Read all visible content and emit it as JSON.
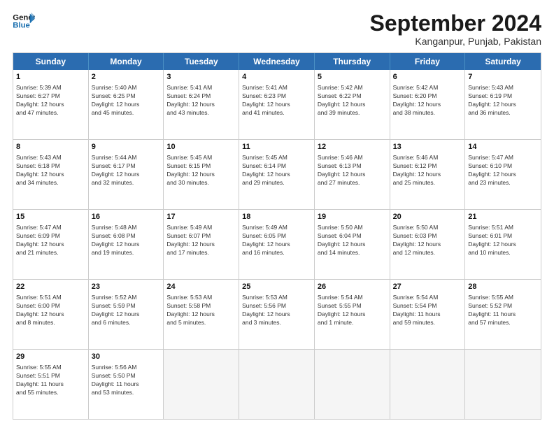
{
  "logo": {
    "line1": "General",
    "line2": "Blue"
  },
  "header": {
    "title": "September 2024",
    "subtitle": "Kanganpur, Punjab, Pakistan"
  },
  "days": [
    "Sunday",
    "Monday",
    "Tuesday",
    "Wednesday",
    "Thursday",
    "Friday",
    "Saturday"
  ],
  "rows": [
    [
      {
        "day": "",
        "empty": true,
        "content": ""
      },
      {
        "day": "2",
        "content": "Sunrise: 5:40 AM\nSunset: 6:25 PM\nDaylight: 12 hours\nand 45 minutes."
      },
      {
        "day": "3",
        "content": "Sunrise: 5:41 AM\nSunset: 6:24 PM\nDaylight: 12 hours\nand 43 minutes."
      },
      {
        "day": "4",
        "content": "Sunrise: 5:41 AM\nSunset: 6:23 PM\nDaylight: 12 hours\nand 41 minutes."
      },
      {
        "day": "5",
        "content": "Sunrise: 5:42 AM\nSunset: 6:22 PM\nDaylight: 12 hours\nand 39 minutes."
      },
      {
        "day": "6",
        "content": "Sunrise: 5:42 AM\nSunset: 6:20 PM\nDaylight: 12 hours\nand 38 minutes."
      },
      {
        "day": "7",
        "content": "Sunrise: 5:43 AM\nSunset: 6:19 PM\nDaylight: 12 hours\nand 36 minutes."
      }
    ],
    [
      {
        "day": "8",
        "content": "Sunrise: 5:43 AM\nSunset: 6:18 PM\nDaylight: 12 hours\nand 34 minutes."
      },
      {
        "day": "9",
        "content": "Sunrise: 5:44 AM\nSunset: 6:17 PM\nDaylight: 12 hours\nand 32 minutes."
      },
      {
        "day": "10",
        "content": "Sunrise: 5:45 AM\nSunset: 6:15 PM\nDaylight: 12 hours\nand 30 minutes."
      },
      {
        "day": "11",
        "content": "Sunrise: 5:45 AM\nSunset: 6:14 PM\nDaylight: 12 hours\nand 29 minutes."
      },
      {
        "day": "12",
        "content": "Sunrise: 5:46 AM\nSunset: 6:13 PM\nDaylight: 12 hours\nand 27 minutes."
      },
      {
        "day": "13",
        "content": "Sunrise: 5:46 AM\nSunset: 6:12 PM\nDaylight: 12 hours\nand 25 minutes."
      },
      {
        "day": "14",
        "content": "Sunrise: 5:47 AM\nSunset: 6:10 PM\nDaylight: 12 hours\nand 23 minutes."
      }
    ],
    [
      {
        "day": "15",
        "content": "Sunrise: 5:47 AM\nSunset: 6:09 PM\nDaylight: 12 hours\nand 21 minutes."
      },
      {
        "day": "16",
        "content": "Sunrise: 5:48 AM\nSunset: 6:08 PM\nDaylight: 12 hours\nand 19 minutes."
      },
      {
        "day": "17",
        "content": "Sunrise: 5:49 AM\nSunset: 6:07 PM\nDaylight: 12 hours\nand 17 minutes."
      },
      {
        "day": "18",
        "content": "Sunrise: 5:49 AM\nSunset: 6:05 PM\nDaylight: 12 hours\nand 16 minutes."
      },
      {
        "day": "19",
        "content": "Sunrise: 5:50 AM\nSunset: 6:04 PM\nDaylight: 12 hours\nand 14 minutes."
      },
      {
        "day": "20",
        "content": "Sunrise: 5:50 AM\nSunset: 6:03 PM\nDaylight: 12 hours\nand 12 minutes."
      },
      {
        "day": "21",
        "content": "Sunrise: 5:51 AM\nSunset: 6:01 PM\nDaylight: 12 hours\nand 10 minutes."
      }
    ],
    [
      {
        "day": "22",
        "content": "Sunrise: 5:51 AM\nSunset: 6:00 PM\nDaylight: 12 hours\nand 8 minutes."
      },
      {
        "day": "23",
        "content": "Sunrise: 5:52 AM\nSunset: 5:59 PM\nDaylight: 12 hours\nand 6 minutes."
      },
      {
        "day": "24",
        "content": "Sunrise: 5:53 AM\nSunset: 5:58 PM\nDaylight: 12 hours\nand 5 minutes."
      },
      {
        "day": "25",
        "content": "Sunrise: 5:53 AM\nSunset: 5:56 PM\nDaylight: 12 hours\nand 3 minutes."
      },
      {
        "day": "26",
        "content": "Sunrise: 5:54 AM\nSunset: 5:55 PM\nDaylight: 12 hours\nand 1 minute."
      },
      {
        "day": "27",
        "content": "Sunrise: 5:54 AM\nSunset: 5:54 PM\nDaylight: 11 hours\nand 59 minutes."
      },
      {
        "day": "28",
        "content": "Sunrise: 5:55 AM\nSunset: 5:52 PM\nDaylight: 11 hours\nand 57 minutes."
      }
    ],
    [
      {
        "day": "29",
        "content": "Sunrise: 5:55 AM\nSunset: 5:51 PM\nDaylight: 11 hours\nand 55 minutes."
      },
      {
        "day": "30",
        "content": "Sunrise: 5:56 AM\nSunset: 5:50 PM\nDaylight: 11 hours\nand 53 minutes."
      },
      {
        "day": "",
        "empty": true,
        "content": ""
      },
      {
        "day": "",
        "empty": true,
        "content": ""
      },
      {
        "day": "",
        "empty": true,
        "content": ""
      },
      {
        "day": "",
        "empty": true,
        "content": ""
      },
      {
        "day": "",
        "empty": true,
        "content": ""
      }
    ]
  ],
  "row0_day1": "1"
}
